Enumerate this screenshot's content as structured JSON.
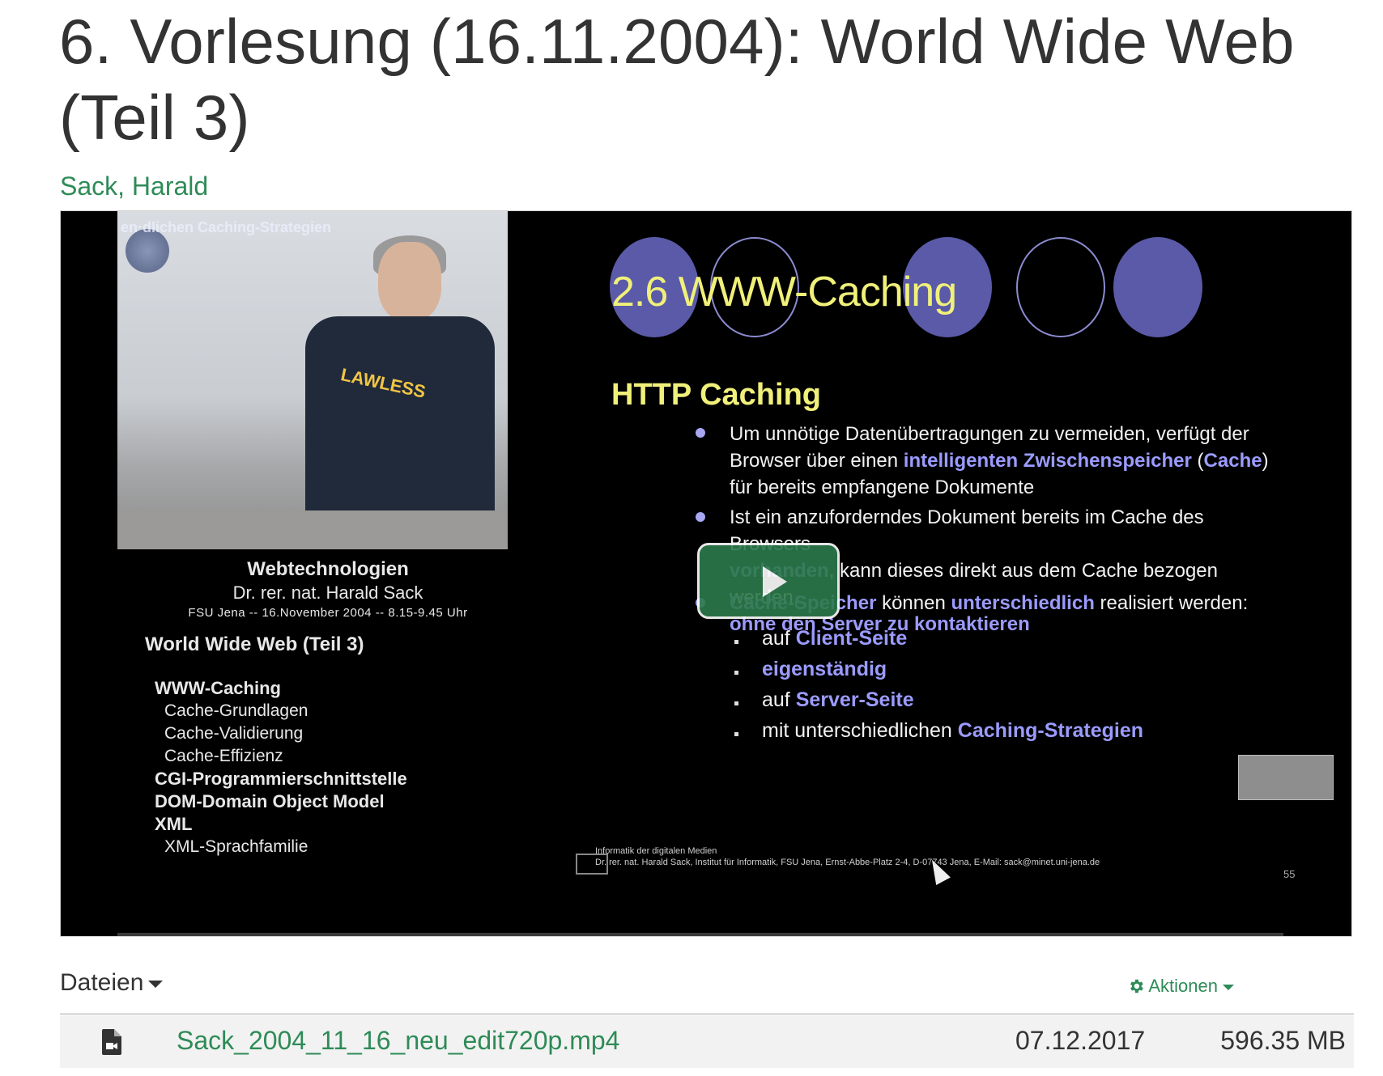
{
  "page": {
    "title": "6. Vorlesung (16.11.2004): World Wide Web (Teil 3)",
    "author": "Sack, Harald"
  },
  "video": {
    "play_icon": "play-icon",
    "camera": {
      "caption": "en·dlichen Caching-Strategien",
      "shirt_text": "LAWLESS"
    },
    "course": {
      "name": "Webtechnologien",
      "lecturer": "Dr. rer. nat. Harald Sack",
      "info": "FSU Jena -- 16.November 2004 -- 8.15-9.45 Uhr"
    },
    "toc": {
      "heading": "World Wide Web (Teil 3)",
      "items": [
        {
          "label": "WWW-Caching",
          "level": 1
        },
        {
          "label": "Cache-Grundlagen",
          "level": 2
        },
        {
          "label": "Cache-Validierung",
          "level": 2
        },
        {
          "label": "Cache-Effizienz",
          "level": 2
        },
        {
          "label": "CGI-Programmierschnittstelle",
          "level": 1
        },
        {
          "label": "DOM-Domain Object Model",
          "level": 1
        },
        {
          "label": "XML",
          "level": 1
        },
        {
          "label": "XML-Sprachfamilie",
          "level": 2
        }
      ]
    },
    "slide": {
      "title": "2.6 WWW-Caching",
      "subtitle": "HTTP Caching",
      "b1_l1": "Um unnötige Datenübertragungen zu vermeiden, verfügt der",
      "b1_l2a": "Browser über einen ",
      "b1_l2b": "intelligenten Zwischenspeicher",
      "b1_l2c": " (",
      "b1_l2d": "Cache",
      "b1_l2e": ")",
      "b1_l3": "für bereits empfangene Dokumente",
      "b2_l1": "Ist ein anzuforderndes Dokument bereits im Cache des Browsers",
      "b2_l2a": "vorhanden",
      "b2_l2b": ", kann dieses direkt aus dem Cache bezogen werden,",
      "b2_l3": "ohne den Server zu kontaktieren",
      "b3a": "Cache-Speicher",
      "b3b": " können ",
      "b3c": "unterschiedlich",
      "b3d": " realisiert werden:",
      "s1a": "auf ",
      "s1b": "Client-Seite",
      "s2": "eigenständig",
      "s3a": "auf ",
      "s3b": "Server-Seite",
      "s4a": "mit unterschiedlichen ",
      "s4b": "Caching-Strategien",
      "footer_l1": "Informatik der digitalen Medien",
      "footer_l2": "Dr. rer. nat. Harald Sack, Institut für Informatik, FSU Jena, Ernst-Abbe-Platz 2-4, D-07743 Jena, E-Mail: sack@minet.uni-jena.de",
      "page_number": "55"
    }
  },
  "files": {
    "header": "Dateien",
    "actions_label": "Aktionen",
    "actions_icon": "gear-icon",
    "rows": [
      {
        "icon": "video-file-icon",
        "name": "Sack_2004_11_16_neu_edit720p.mp4",
        "date": "07.12.2017",
        "size": "596.35 MB"
      }
    ]
  },
  "colors": {
    "link_green": "#2e8b57",
    "slide_yellow": "#f0f07a",
    "slide_highlight": "#9b9bff",
    "play_button": "#2d7a4c"
  }
}
